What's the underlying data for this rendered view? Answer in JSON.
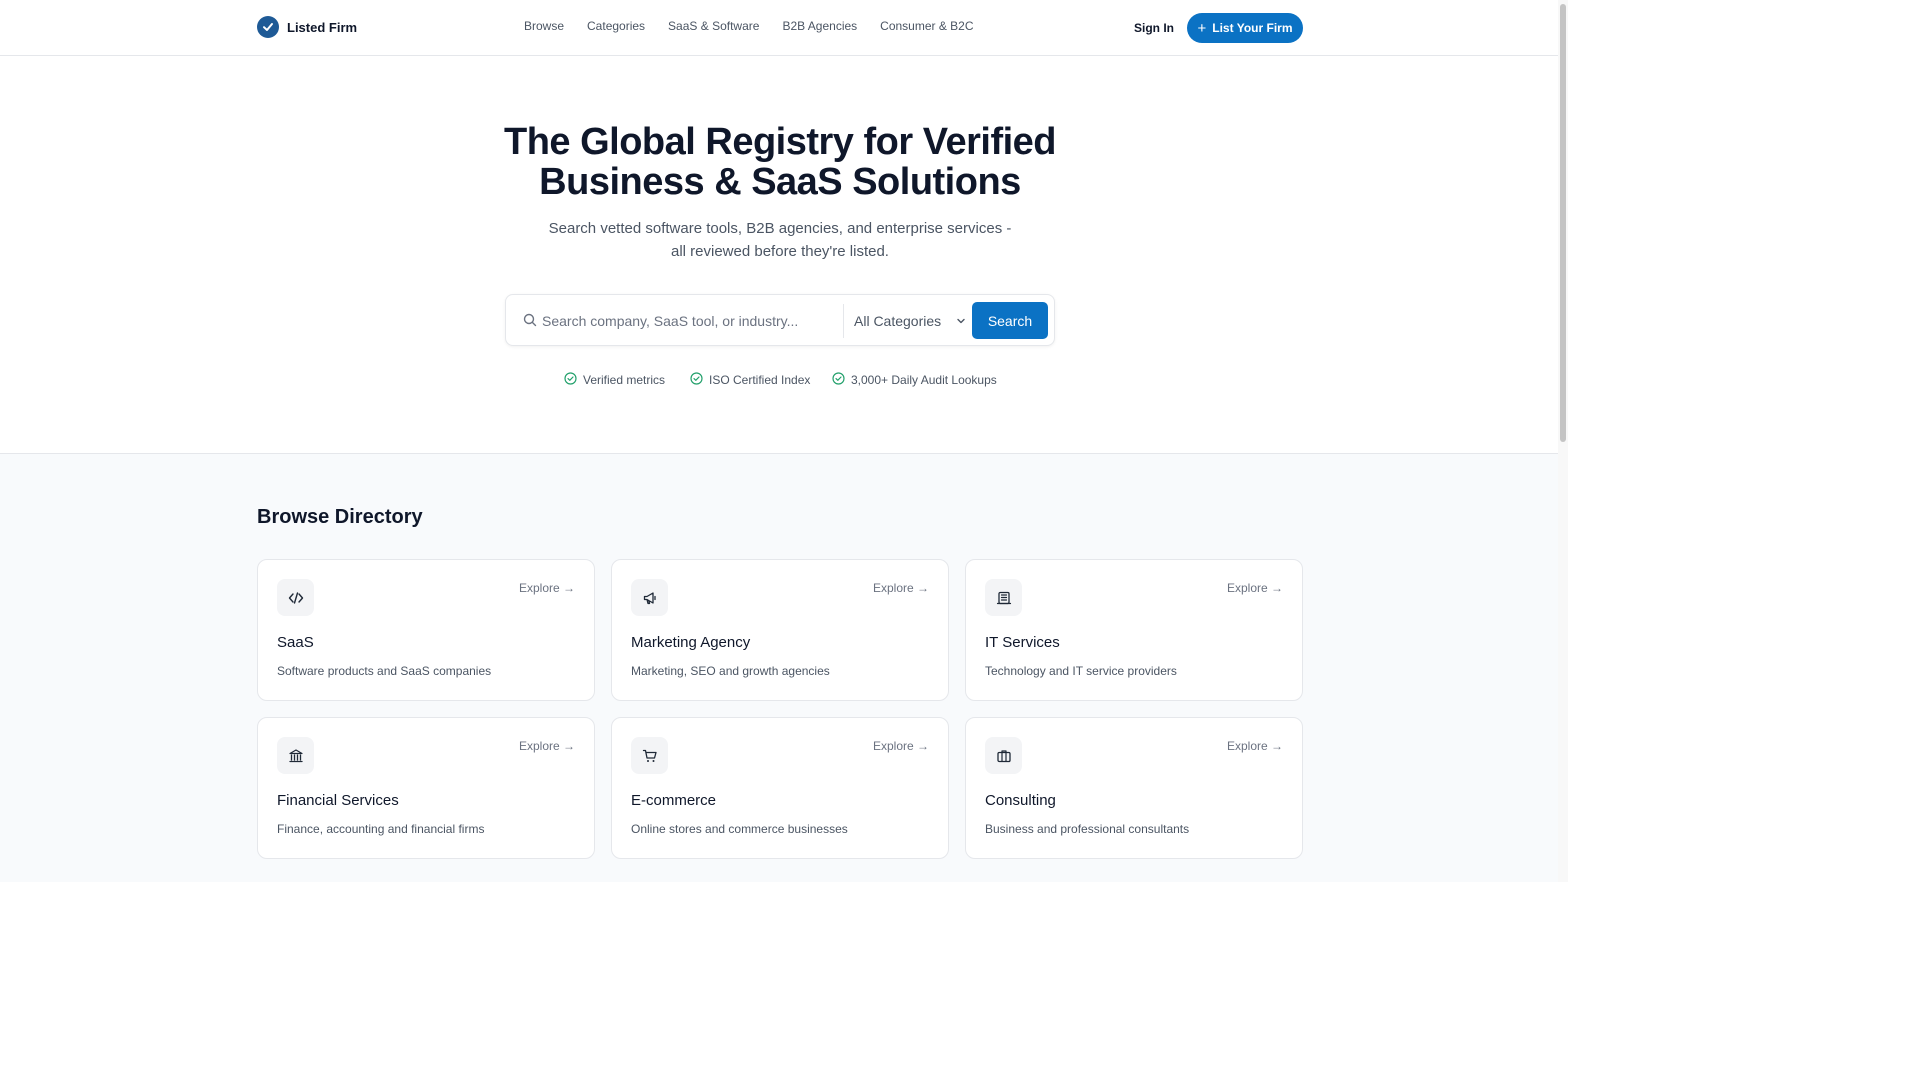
{
  "header": {
    "brand": "Listed Firm",
    "nav": [
      "Browse",
      "Categories",
      "SaaS & Software",
      "B2B Agencies",
      "Consumer & B2C"
    ],
    "sign_in": "Sign In",
    "list_button": "List Your Firm"
  },
  "hero": {
    "title_line1": "The Global Registry for Verified",
    "title_line2": "Business & SaaS Solutions",
    "subtitle_line1": "Search vetted software tools, B2B agencies, and enterprise services -",
    "subtitle_line2": "all reviewed before they're listed.",
    "search_placeholder": "Search company, SaaS tool, or industry...",
    "category_selected": "All Categories",
    "search_button": "Search",
    "trust_items": [
      "Verified metrics",
      "ISO Certified Index",
      "3,000+ Daily Audit Lookups"
    ]
  },
  "directory": {
    "title": "Browse Directory",
    "explore_label": "Explore →",
    "cards": [
      {
        "name": "SaaS",
        "desc": "Software products and SaaS companies",
        "icon": "code-icon"
      },
      {
        "name": "Marketing Agency",
        "desc": "Marketing, SEO and growth agencies",
        "icon": "megaphone-icon"
      },
      {
        "name": "IT Services",
        "desc": "Technology and IT service providers",
        "icon": "server-icon"
      },
      {
        "name": "Financial Services",
        "desc": "Finance, accounting and financial firms",
        "icon": "bank-icon"
      },
      {
        "name": "E-commerce",
        "desc": "Online stores and commerce businesses",
        "icon": "cart-icon"
      },
      {
        "name": "Consulting",
        "desc": "Business and professional consultants",
        "icon": "briefcase-icon"
      }
    ]
  },
  "colors": {
    "primary": "#0b72c4",
    "logo": "#1e5a96",
    "check_green": "#22a06b"
  }
}
